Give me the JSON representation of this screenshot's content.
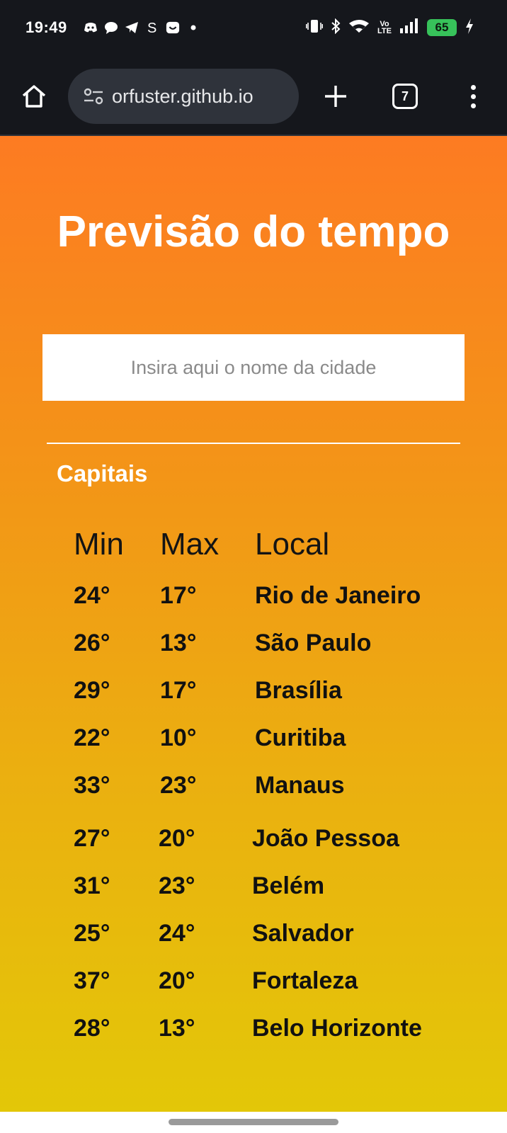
{
  "status_bar": {
    "time": "19:49",
    "left_icons": [
      "discord-icon",
      "chat-bubble-icon",
      "telegram-icon",
      "skype-icon",
      "messenger-icon",
      "dot-icon"
    ],
    "right_icons": [
      "vibrate-icon",
      "bluetooth-icon",
      "wifi-icon",
      "volte-icon",
      "signal-icon",
      "battery-icon",
      "charging-icon"
    ],
    "volte_label": "Vo\nLTE",
    "battery": "65",
    "battery_color": "#37c25a"
  },
  "browser": {
    "url": "orfuster.github.io",
    "tab_count": "7",
    "icons": [
      "home-icon",
      "site-settings-icon",
      "new-tab-icon",
      "tab-switcher-icon",
      "more-menu-icon"
    ]
  },
  "page": {
    "title": "Previsão do tempo",
    "search_placeholder": "Insira aqui o nome da cidade",
    "section_title": "Capitais",
    "gradient": [
      "#fd7b22",
      "#e3c708"
    ],
    "table": {
      "headers": {
        "min": "Min",
        "max": "Max",
        "local": "Local"
      },
      "rows": [
        {
          "min": "24°",
          "max": "17°",
          "local": "Rio de Janeiro"
        },
        {
          "min": "26°",
          "max": "13°",
          "local": "São Paulo"
        },
        {
          "min": "29°",
          "max": "17°",
          "local": "Brasília"
        },
        {
          "min": "22°",
          "max": "10°",
          "local": "Curitiba"
        },
        {
          "min": "33°",
          "max": "23°",
          "local": "Manaus"
        },
        {
          "min": "27°",
          "max": "20°",
          "local": "João Pessoa"
        },
        {
          "min": "31°",
          "max": "23°",
          "local": "Belém"
        },
        {
          "min": "25°",
          "max": "24°",
          "local": "Salvador"
        },
        {
          "min": "37°",
          "max": "20°",
          "local": "Fortaleza"
        },
        {
          "min": "28°",
          "max": "13°",
          "local": "Belo Horizonte"
        }
      ]
    }
  }
}
